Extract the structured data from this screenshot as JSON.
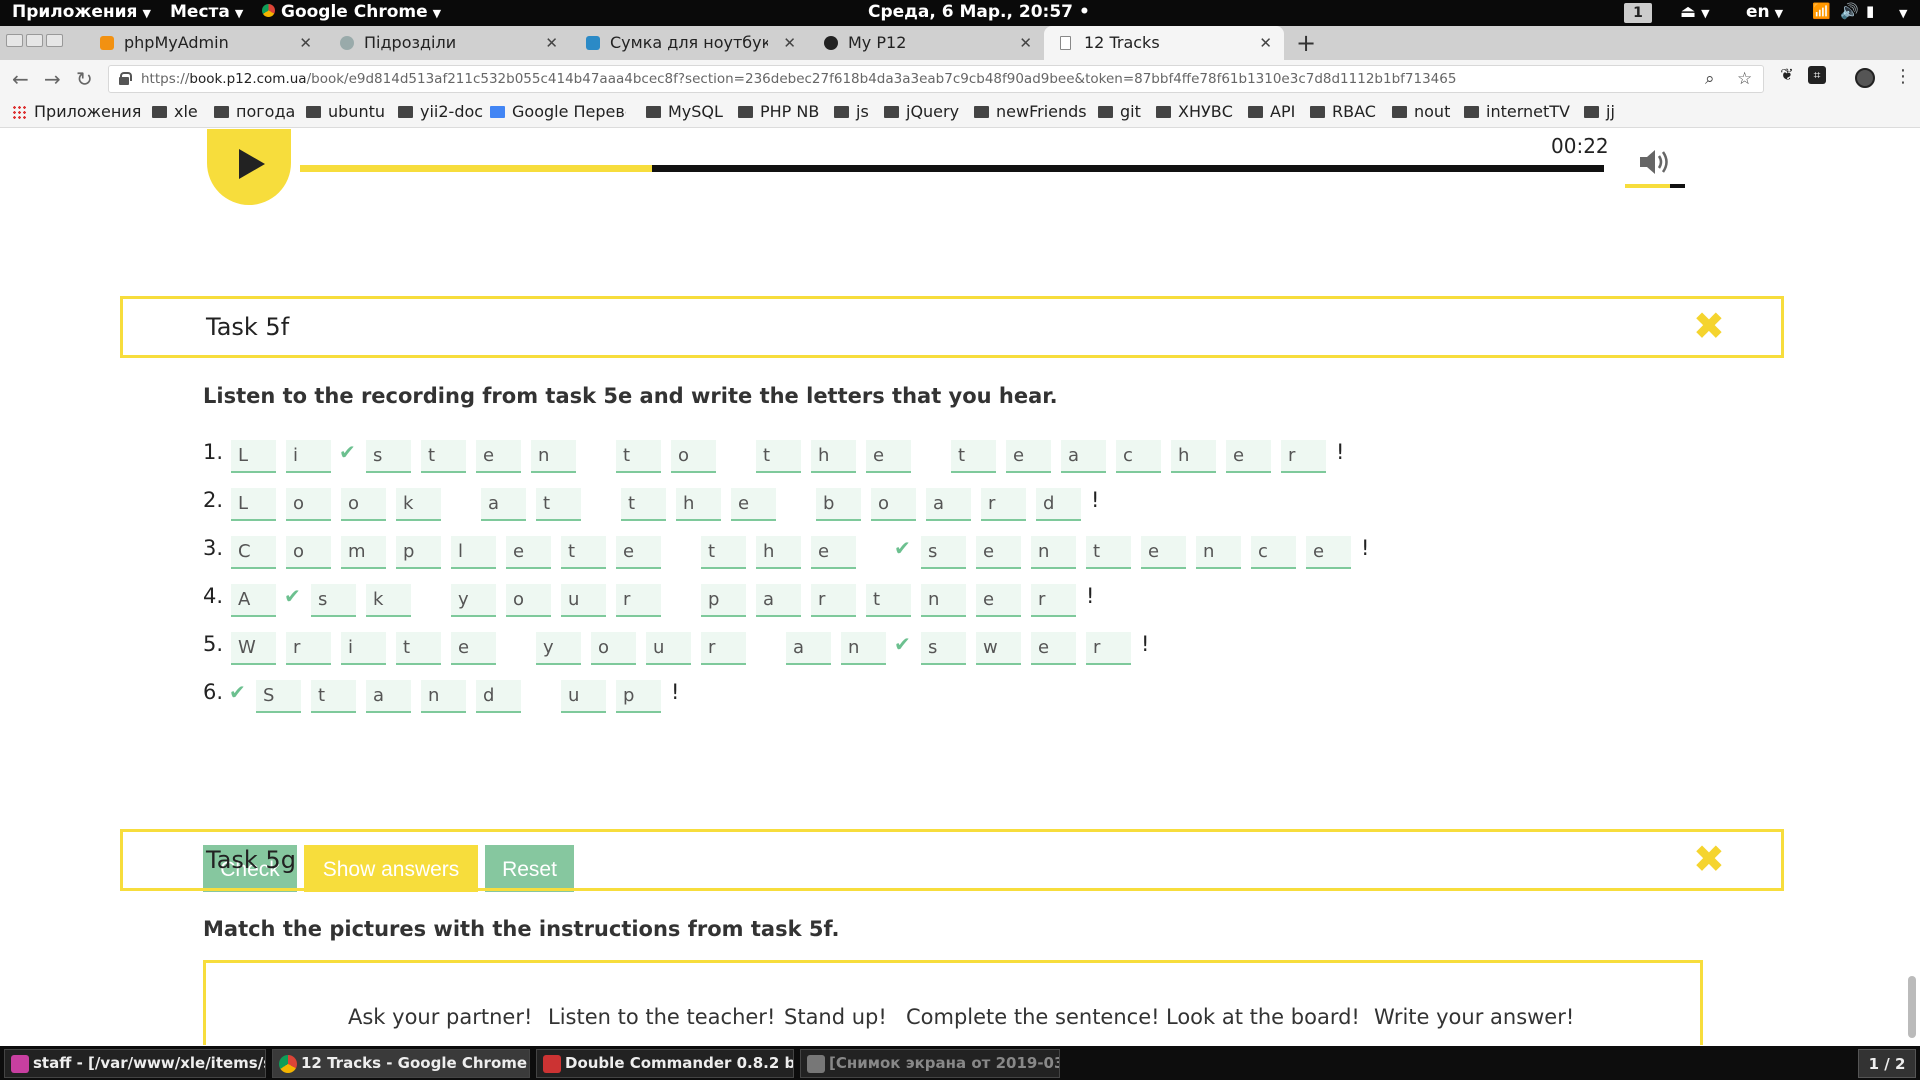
{
  "top_panel": {
    "apps_menu": "Приложения",
    "places_menu": "Места",
    "active_app": "Google Chrome",
    "clock": "Среда,  6 Мар., 20:57",
    "clock_dot": "•",
    "workspace": "1",
    "language": "en"
  },
  "tabs": [
    {
      "label": "phpMyAdmin",
      "icon": "phpmyadmin-icon",
      "color": "#f29111"
    },
    {
      "label": "Підрозділи",
      "icon": "page-icon",
      "color": "#9aa"
    },
    {
      "label": "Сумка для ноутбуков С",
      "icon": "shop-icon",
      "color": "#2b8ac6"
    },
    {
      "label": "My P12",
      "icon": "p12-icon",
      "color": "#222"
    },
    {
      "label": "12 Tracks",
      "icon": "document-icon",
      "color": "#888"
    }
  ],
  "new_tab_symbol": "+",
  "tab_close_symbol": "✕",
  "address_bar": {
    "url_prefix": "https://",
    "url_host": "book.p12.com.ua",
    "url_path": "/book/e9d814d513af211c532b055c414b47aaa4bcec8f?section=236debec27f618b4da3a3eab7c9cb48f90ad9bee&token=87bbf4ffe78f61b1310e3c7d8d1112b1bf713465"
  },
  "bookmarks": [
    "Приложения",
    "xle",
    "погода",
    "ubuntu",
    "yii2-doc",
    "Google Перевод",
    "MySQL",
    "PHP NB",
    "js",
    "jQuery",
    "newFriends",
    "git",
    "ХНУВС",
    "API",
    "RBAC",
    "nout",
    "internetTV",
    "jj"
  ],
  "player": {
    "time": "00:22",
    "progress_fraction": 0.27,
    "volume_fraction": 0.75
  },
  "task_5f": {
    "title": "Task 5f",
    "close_symbol": "✖",
    "instruction": "Listen to the recording from task 5e and write the letters that you hear.",
    "sentences": [
      {
        "num": "1.",
        "words": [
          [
            "L",
            "i",
            "s",
            "t",
            "e",
            "n"
          ],
          [
            "t",
            "o"
          ],
          [
            "t",
            "h",
            "e"
          ],
          [
            "t",
            "e",
            "a",
            "c",
            "h",
            "e",
            "r"
          ]
        ],
        "checks": [
          [
            0,
            2
          ]
        ]
      },
      {
        "num": "2.",
        "words": [
          [
            "L",
            "o",
            "o",
            "k"
          ],
          [
            "a",
            "t"
          ],
          [
            "t",
            "h",
            "e"
          ],
          [
            "b",
            "o",
            "a",
            "r",
            "d"
          ]
        ],
        "checks": []
      },
      {
        "num": "3.",
        "words": [
          [
            "C",
            "o",
            "m",
            "p",
            "l",
            "e",
            "t",
            "e"
          ],
          [
            "t",
            "h",
            "e"
          ],
          [
            "s",
            "e",
            "n",
            "t",
            "e",
            "n",
            "c",
            "e"
          ]
        ],
        "checks": [
          [
            2,
            0
          ]
        ]
      },
      {
        "num": "4.",
        "words": [
          [
            "A",
            "s",
            "k"
          ],
          [
            "y",
            "o",
            "u",
            "r"
          ],
          [
            "p",
            "a",
            "r",
            "t",
            "n",
            "e",
            "r"
          ]
        ],
        "checks": [
          [
            0,
            1
          ]
        ]
      },
      {
        "num": "5.",
        "words": [
          [
            "W",
            "r",
            "i",
            "t",
            "e"
          ],
          [
            "y",
            "o",
            "u",
            "r"
          ],
          [
            "a",
            "n",
            "s",
            "w",
            "e",
            "r"
          ]
        ],
        "checks": [
          [
            2,
            2
          ]
        ]
      },
      {
        "num": "6.",
        "words": [
          [
            "S",
            "t",
            "a",
            "n",
            "d"
          ],
          [
            "u",
            "p"
          ]
        ],
        "checks": [
          [
            0,
            0
          ]
        ]
      }
    ],
    "exclamation": "!",
    "buttons": {
      "check": "Check",
      "show": "Show answers",
      "reset": "Reset"
    }
  },
  "task_5g": {
    "title": "Task 5g",
    "close_symbol": "✖",
    "instruction": "Match the pictures with the instructions from task 5f.",
    "options": [
      "Ask your partner!",
      "Listen to the teacher!",
      "Stand up!",
      "Complete the sentence!",
      "Look at the board!",
      "Write your answer!"
    ]
  },
  "taskbar": {
    "items": [
      {
        "label": "staff - [/var/www/xle/items/s...",
        "icon": "phpstorm-icon",
        "color": "#c83fa0"
      },
      {
        "label": "12 Tracks - Google Chrome",
        "icon": "chrome-icon",
        "color": "#4285f4"
      },
      {
        "label": "Double Commander 0.8.2 b...",
        "icon": "double-commander-icon",
        "color": "#c33"
      },
      {
        "label": "[Снимок экрана от 2019-03...",
        "icon": "screenshot-icon",
        "color": "#777"
      }
    ],
    "pager": "1 / 2"
  },
  "colors": {
    "accent_yellow": "#f7dd3c",
    "accent_green": "#86c79f",
    "check_green": "#6cc08f"
  }
}
